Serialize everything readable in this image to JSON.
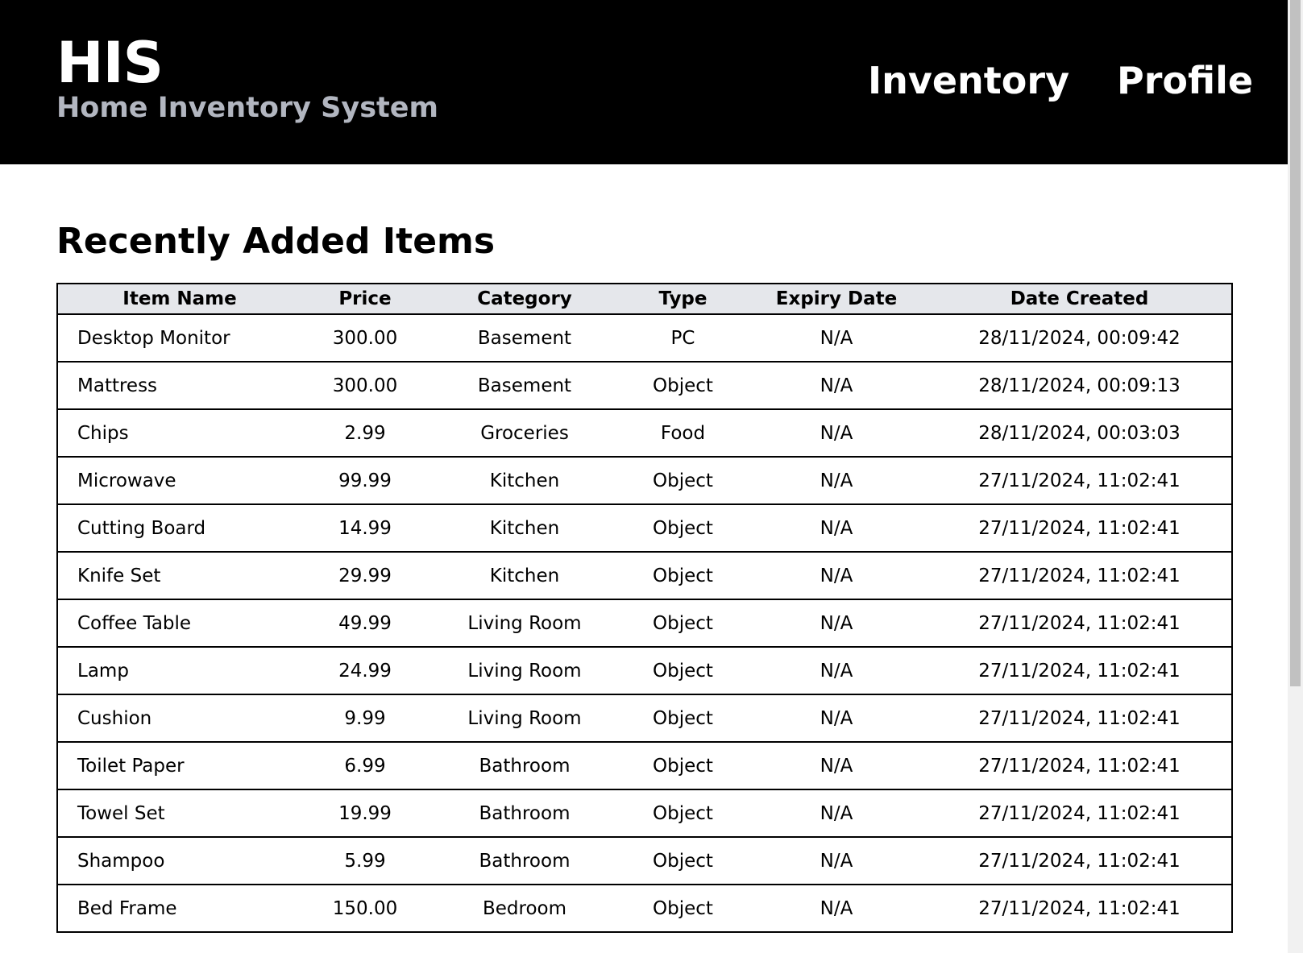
{
  "header": {
    "title": "HIS",
    "subtitle": "Home Inventory System",
    "nav": {
      "inventory": "Inventory",
      "profile": "Profile"
    }
  },
  "main": {
    "title": "Recently Added Items",
    "table": {
      "headers": {
        "name": "Item Name",
        "price": "Price",
        "category": "Category",
        "type": "Type",
        "expiry": "Expiry Date",
        "created": "Date Created"
      },
      "rows": [
        {
          "name": "Desktop Monitor",
          "price": "300.00",
          "category": "Basement",
          "type": "PC",
          "expiry": "N/A",
          "created": "28/11/2024, 00:09:42"
        },
        {
          "name": "Mattress",
          "price": "300.00",
          "category": "Basement",
          "type": "Object",
          "expiry": "N/A",
          "created": "28/11/2024, 00:09:13"
        },
        {
          "name": "Chips",
          "price": "2.99",
          "category": "Groceries",
          "type": "Food",
          "expiry": "N/A",
          "created": "28/11/2024, 00:03:03"
        },
        {
          "name": "Microwave",
          "price": "99.99",
          "category": "Kitchen",
          "type": "Object",
          "expiry": "N/A",
          "created": "27/11/2024, 11:02:41"
        },
        {
          "name": "Cutting Board",
          "price": "14.99",
          "category": "Kitchen",
          "type": "Object",
          "expiry": "N/A",
          "created": "27/11/2024, 11:02:41"
        },
        {
          "name": "Knife Set",
          "price": "29.99",
          "category": "Kitchen",
          "type": "Object",
          "expiry": "N/A",
          "created": "27/11/2024, 11:02:41"
        },
        {
          "name": "Coffee Table",
          "price": "49.99",
          "category": "Living Room",
          "type": "Object",
          "expiry": "N/A",
          "created": "27/11/2024, 11:02:41"
        },
        {
          "name": "Lamp",
          "price": "24.99",
          "category": "Living Room",
          "type": "Object",
          "expiry": "N/A",
          "created": "27/11/2024, 11:02:41"
        },
        {
          "name": "Cushion",
          "price": "9.99",
          "category": "Living Room",
          "type": "Object",
          "expiry": "N/A",
          "created": "27/11/2024, 11:02:41"
        },
        {
          "name": "Toilet Paper",
          "price": "6.99",
          "category": "Bathroom",
          "type": "Object",
          "expiry": "N/A",
          "created": "27/11/2024, 11:02:41"
        },
        {
          "name": "Towel Set",
          "price": "19.99",
          "category": "Bathroom",
          "type": "Object",
          "expiry": "N/A",
          "created": "27/11/2024, 11:02:41"
        },
        {
          "name": "Shampoo",
          "price": "5.99",
          "category": "Bathroom",
          "type": "Object",
          "expiry": "N/A",
          "created": "27/11/2024, 11:02:41"
        },
        {
          "name": "Bed Frame",
          "price": "150.00",
          "category": "Bedroom",
          "type": "Object",
          "expiry": "N/A",
          "created": "27/11/2024, 11:02:41"
        }
      ]
    }
  },
  "colors": {
    "header_background": "#000000",
    "subtitle_text": "#b2b6c0",
    "table_header_background": "#e5e7eb",
    "border": "#000000"
  }
}
